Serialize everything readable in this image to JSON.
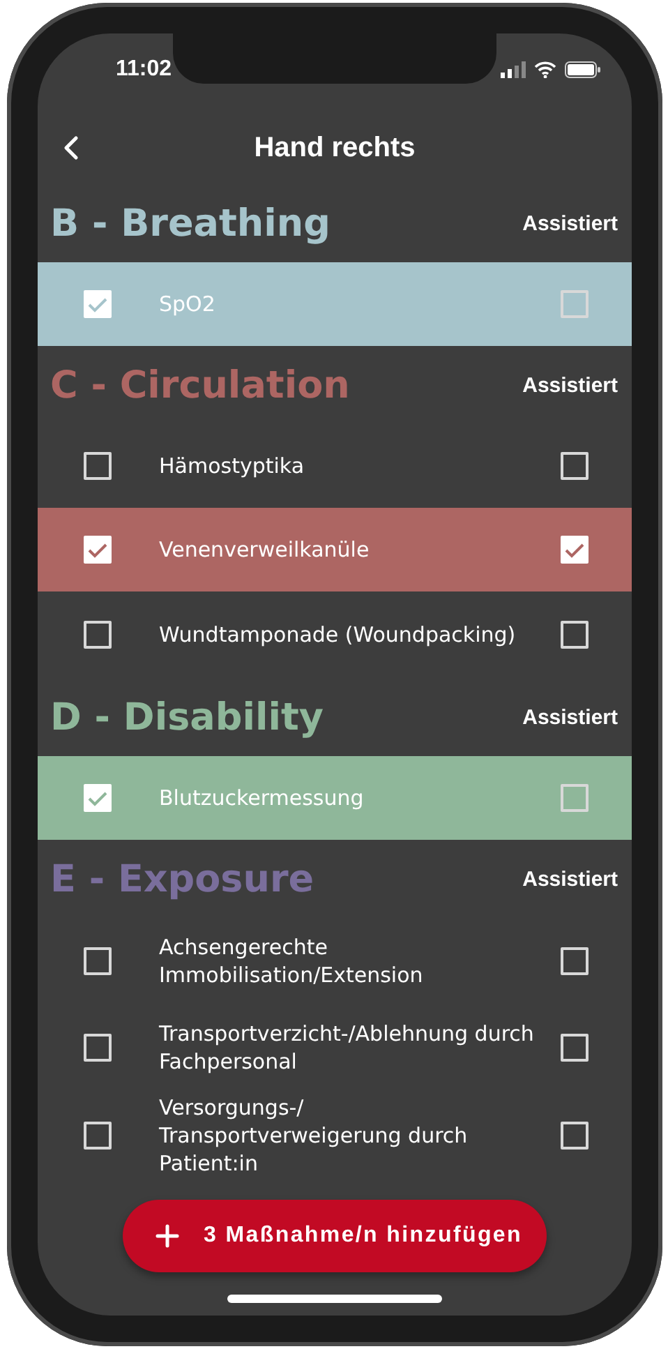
{
  "status_bar": {
    "time": "11:02"
  },
  "header": {
    "title": "Hand rechts"
  },
  "sections": [
    {
      "title": "B - Breathing",
      "color": "#a6c4cb",
      "column_label": "Assistiert",
      "items": [
        {
          "label": "SpO2",
          "checked": true,
          "assisted": false
        }
      ]
    },
    {
      "title": "C - Circulation",
      "color": "#ad6663",
      "column_label": "Assistiert",
      "items": [
        {
          "label": "Hämostyptika",
          "checked": false,
          "assisted": false
        },
        {
          "label": "Venenverweilkanüle",
          "checked": true,
          "assisted": true
        },
        {
          "label": "Wundtamponade (Woundpacking)",
          "checked": false,
          "assisted": false
        }
      ]
    },
    {
      "title": "D - Disability",
      "color": "#8fb79a",
      "column_label": "Assistiert",
      "items": [
        {
          "label": "Blutzuckermessung",
          "checked": true,
          "assisted": false
        }
      ]
    },
    {
      "title": "E - Exposure",
      "color": "#7a6e9c",
      "column_label": "Assistiert",
      "items": [
        {
          "label": "Achsengerechte Immobilisation/Extension",
          "checked": false,
          "assisted": false
        },
        {
          "label": "Transportverzicht-/Ablehnung durch Fachpersonal",
          "checked": false,
          "assisted": false
        },
        {
          "label": "Versorgungs-/ Transportverweigerung durch Patient:in",
          "checked": false,
          "assisted": false
        }
      ]
    }
  ],
  "action_button": {
    "label": "3 Maßnahme/n hinzufügen"
  }
}
